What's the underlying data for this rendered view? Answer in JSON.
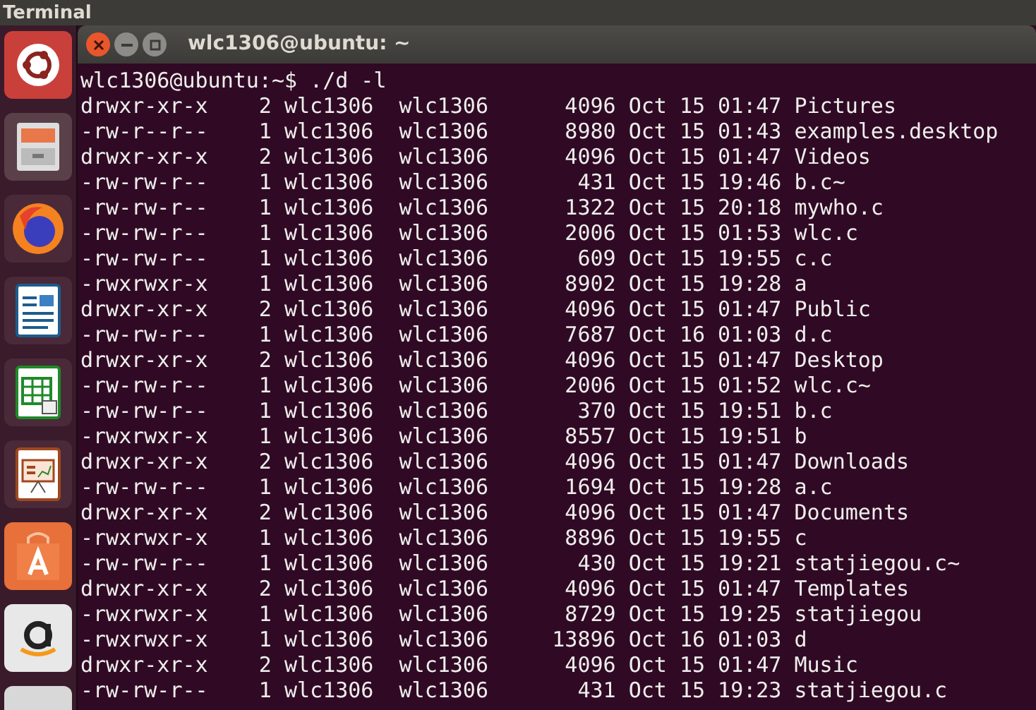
{
  "top_bar": {
    "title": "Terminal"
  },
  "window": {
    "title": "wlc1306@ubuntu: ~"
  },
  "terminal": {
    "lines": [
      "wlc1306@ubuntu:~$ ./d -l",
      "drwxr-xr-x    2 wlc1306  wlc1306      4096 Oct 15 01:47 Pictures",
      "-rw-r--r--    1 wlc1306  wlc1306      8980 Oct 15 01:43 examples.desktop",
      "drwxr-xr-x    2 wlc1306  wlc1306      4096 Oct 15 01:47 Videos",
      "-rw-rw-r--    1 wlc1306  wlc1306       431 Oct 15 19:46 b.c~",
      "-rw-rw-r--    1 wlc1306  wlc1306      1322 Oct 15 20:18 mywho.c",
      "-rw-rw-r--    1 wlc1306  wlc1306      2006 Oct 15 01:53 wlc.c",
      "-rw-rw-r--    1 wlc1306  wlc1306       609 Oct 15 19:55 c.c",
      "-rwxrwxr-x    1 wlc1306  wlc1306      8902 Oct 15 19:28 a",
      "drwxr-xr-x    2 wlc1306  wlc1306      4096 Oct 15 01:47 Public",
      "-rw-rw-r--    1 wlc1306  wlc1306      7687 Oct 16 01:03 d.c",
      "drwxr-xr-x    2 wlc1306  wlc1306      4096 Oct 15 01:47 Desktop",
      "-rw-rw-r--    1 wlc1306  wlc1306      2006 Oct 15 01:52 wlc.c~",
      "-rw-rw-r--    1 wlc1306  wlc1306       370 Oct 15 19:51 b.c",
      "-rwxrwxr-x    1 wlc1306  wlc1306      8557 Oct 15 19:51 b",
      "drwxr-xr-x    2 wlc1306  wlc1306      4096 Oct 15 01:47 Downloads",
      "-rw-rw-r--    1 wlc1306  wlc1306      1694 Oct 15 19:28 a.c",
      "drwxr-xr-x    2 wlc1306  wlc1306      4096 Oct 15 01:47 Documents",
      "-rwxrwxr-x    1 wlc1306  wlc1306      8896 Oct 15 19:55 c",
      "-rw-rw-r--    1 wlc1306  wlc1306       430 Oct 15 19:21 statjiegou.c~",
      "drwxr-xr-x    2 wlc1306  wlc1306      4096 Oct 15 01:47 Templates",
      "-rwxrwxr-x    1 wlc1306  wlc1306      8729 Oct 15 19:25 statjiegou",
      "-rwxrwxr-x    1 wlc1306  wlc1306     13896 Oct 16 01:03 d",
      "drwxr-xr-x    2 wlc1306  wlc1306      4096 Oct 15 01:47 Music",
      "-rw-rw-r--    1 wlc1306  wlc1306       431 Oct 15 19:23 statjiegou.c"
    ]
  }
}
